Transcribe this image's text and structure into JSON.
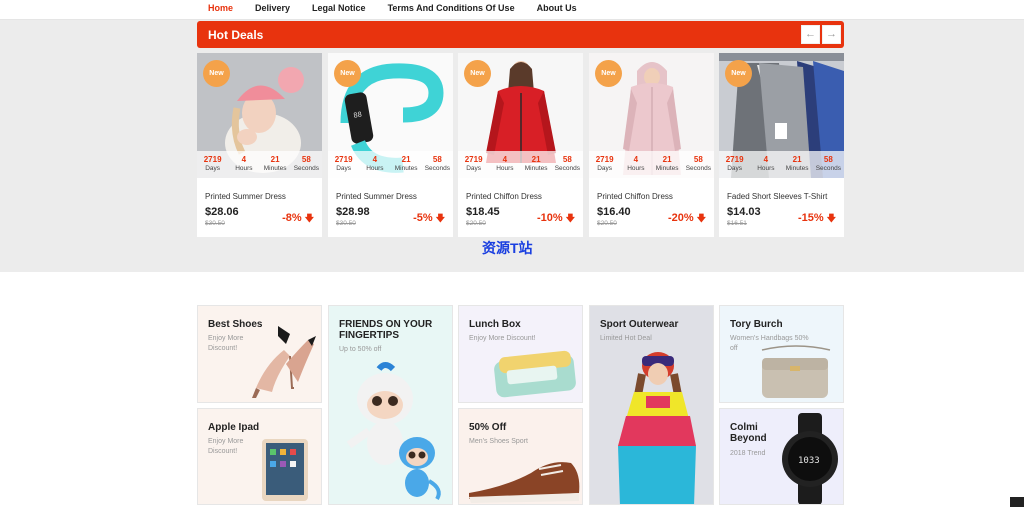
{
  "nav": {
    "items": [
      "Home",
      "Delivery",
      "Legal Notice",
      "Terms And Conditions Of Use",
      "About Us"
    ]
  },
  "deals": {
    "title": "Hot Deals",
    "prev_icon": "←",
    "next_icon": "→",
    "timer_units": [
      "Days",
      "Hours",
      "Minutes",
      "Seconds"
    ],
    "products": [
      {
        "badge": "New",
        "timer": [
          "2719",
          "4",
          "21",
          "58"
        ],
        "name": "Printed Summer Dress",
        "price": "$28.06",
        "old_price": "$30.50",
        "discount": "-8%",
        "image": "knit-hat-photo"
      },
      {
        "badge": "New",
        "timer": [
          "2719",
          "4",
          "21",
          "58"
        ],
        "name": "Printed Summer Dress",
        "price": "$28.98",
        "old_price": "$30.50",
        "discount": "-5%",
        "image": "fitness-band-photo"
      },
      {
        "badge": "New",
        "timer": [
          "2719",
          "4",
          "21",
          "58"
        ],
        "name": "Printed Chiffon Dress",
        "price": "$18.45",
        "old_price": "$20.50",
        "discount": "-10%",
        "image": "red-jacket-photo"
      },
      {
        "badge": "New",
        "timer": [
          "2719",
          "4",
          "21",
          "58"
        ],
        "name": "Printed Chiffon Dress",
        "price": "$16.40",
        "old_price": "$20.50",
        "discount": "-20%",
        "image": "pink-coat-photo"
      },
      {
        "badge": "New",
        "timer": [
          "2719",
          "4",
          "21",
          "58"
        ],
        "name": "Faded Short Sleeves T-Shirt",
        "price": "$14.03",
        "old_price": "$16.51",
        "discount": "-15%",
        "image": "sweaters-photo"
      }
    ],
    "down_icon": "arrow-down-icon"
  },
  "watermark": "资源T站",
  "categories": [
    {
      "title": "Best Shoes",
      "sub": "Enjoy More Discount!",
      "image": "heels-photo"
    },
    {
      "title": "FRIENDS ON YOUR FINGERTIPS",
      "sub": "Up to 50% off",
      "image": "monkey-toys-photo"
    },
    {
      "title": "Lunch Box",
      "sub": "Enjoy More Discount!",
      "image": "lunch-box-photo"
    },
    {
      "title": "Sport Outerwear",
      "sub": "Limited Hot Deal",
      "image": "ski-jacket-photo"
    },
    {
      "title": "Tory Burch",
      "sub": "Women's Handbags 50% off",
      "image": "handbag-photo"
    },
    {
      "title": "Apple Ipad",
      "sub": "Enjoy More Discount!",
      "image": "ipad-photo"
    },
    {
      "title": "50% Off",
      "sub": "Men's Shoes Sport",
      "image": "brown-shoe-photo"
    },
    {
      "title": "Colmi Beyond",
      "sub": "2018 Trend",
      "image": "smartwatch-photo"
    }
  ],
  "colors": {
    "accent": "#e8330e",
    "badge": "#f4a24a",
    "band": "#ececec",
    "watermark": "#1a3fe0"
  }
}
